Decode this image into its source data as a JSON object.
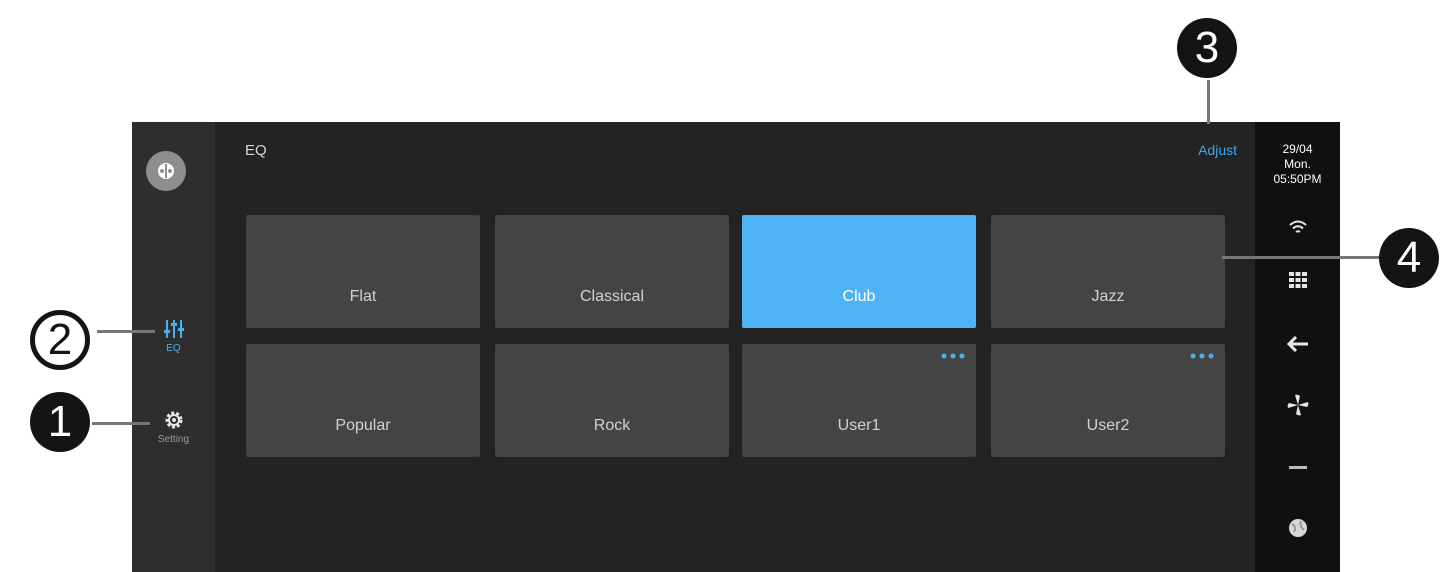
{
  "sidebar": {
    "items": [
      {
        "label": "EQ"
      },
      {
        "label": "Setting"
      }
    ]
  },
  "header": {
    "title": "EQ",
    "adjust_label": "Adjust"
  },
  "presets": [
    {
      "label": "Flat"
    },
    {
      "label": "Classical"
    },
    {
      "label": "Club",
      "selected": true
    },
    {
      "label": "Jazz"
    },
    {
      "label": "Popular"
    },
    {
      "label": "Rock"
    },
    {
      "label": "User1",
      "has_more_menu": true
    },
    {
      "label": "User2",
      "has_more_menu": true
    }
  ],
  "status_bar": {
    "date": "29/04",
    "day": "Mon.",
    "time": "05:50PM",
    "icons": [
      "wifi-icon",
      "grid-icon",
      "back-arrow-icon",
      "fan-icon",
      "minus-icon",
      "globe-icon"
    ]
  },
  "callouts": [
    "1",
    "2",
    "3",
    "4"
  ],
  "colors": {
    "accent": "#4db3f4",
    "tile": "#444444",
    "background": "#232323",
    "sidebar": "#2e2e2e",
    "status_bar": "#101010"
  }
}
